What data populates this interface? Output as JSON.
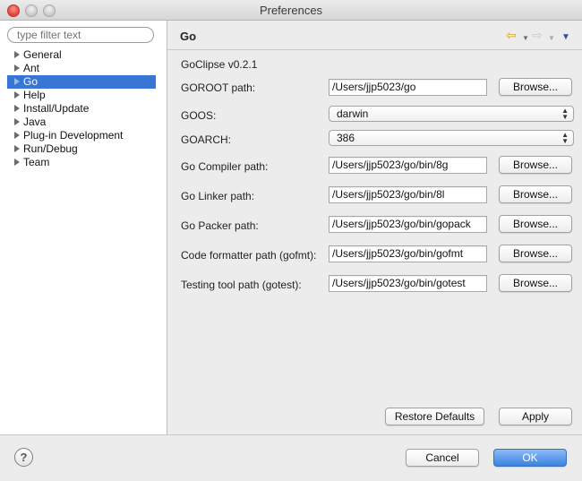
{
  "window": {
    "title": "Preferences"
  },
  "sidebar": {
    "filter_placeholder": "type filter text",
    "items": [
      {
        "label": "General"
      },
      {
        "label": "Ant"
      },
      {
        "label": "Go",
        "selected": true
      },
      {
        "label": "Help"
      },
      {
        "label": "Install/Update"
      },
      {
        "label": "Java"
      },
      {
        "label": "Plug-in Development"
      },
      {
        "label": "Run/Debug"
      },
      {
        "label": "Team"
      }
    ]
  },
  "page": {
    "title": "Go",
    "version": "GoClipse v0.2.1",
    "goroot": {
      "label": "GOROOT path:",
      "value": "/Users/jjp5023/go",
      "button": "Browse..."
    },
    "goos": {
      "label": "GOOS:",
      "value": "darwin"
    },
    "goarch": {
      "label": "GOARCH:",
      "value": "386"
    },
    "compiler": {
      "label": "Go Compiler path:",
      "value": "/Users/jjp5023/go/bin/8g",
      "button": "Browse..."
    },
    "linker": {
      "label": "Go Linker path:",
      "value": "/Users/jjp5023/go/bin/8l",
      "button": "Browse..."
    },
    "packer": {
      "label": "Go Packer path:",
      "value": "/Users/jjp5023/go/bin/gopack",
      "button": "Browse..."
    },
    "gofmt": {
      "label": "Code formatter path (gofmt):",
      "value": "/Users/jjp5023/go/bin/gofmt",
      "button": "Browse..."
    },
    "gotest": {
      "label": "Testing tool path (gotest):",
      "value": "/Users/jjp5023/go/bin/gotest",
      "button": "Browse..."
    },
    "restore_defaults": "Restore Defaults",
    "apply": "Apply"
  },
  "footer": {
    "help_glyph": "?",
    "cancel": "Cancel",
    "ok": "OK"
  },
  "colors": {
    "selection": "#3876d6",
    "ok_button": "#3a82e0",
    "back_arrow": "#d7a31a"
  }
}
